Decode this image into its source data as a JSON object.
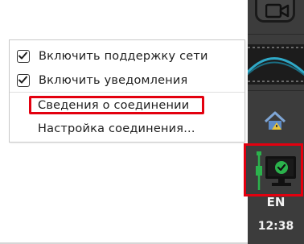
{
  "context_menu": {
    "items": [
      {
        "label": "Включить поддержку сети",
        "checked": true
      },
      {
        "label": "Включить уведомления",
        "checked": true
      },
      {
        "label": "Сведения о соединении",
        "highlighted": true
      },
      {
        "label": "Настройка соединения..."
      }
    ]
  },
  "taskbar": {
    "icons": [
      "video-camera-icon",
      "network-manager-tray-icon",
      "network-connected-icon"
    ],
    "language": "EN",
    "time": "12:38"
  },
  "colors": {
    "panel": "#3c3c3c",
    "highlight": "#e3000f",
    "menu_text": "#1e1e1e",
    "network_ok": "#2bb24c"
  }
}
